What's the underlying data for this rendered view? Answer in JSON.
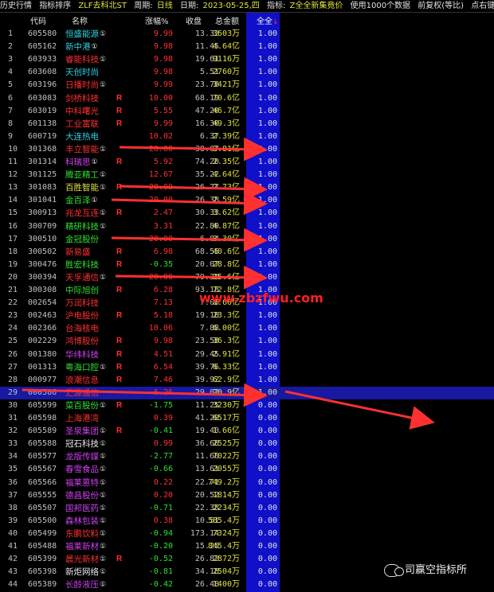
{
  "header": {
    "history": "历史行情",
    "ranking": "指标排序",
    "formula": "ZLF去科北ST",
    "period_label": "周期:",
    "period_value": "日线",
    "date_label": "日期:",
    "date_value": "2023-05-25,四",
    "indicator_label": "指标:",
    "indicator_value": "Z全全新集竟价",
    "data_note": "使用1000个数据",
    "adjust": "前复权(等比)",
    "tail": "点右键"
  },
  "columns": {
    "code": "代码",
    "name": "名称",
    "change": "涨幅%",
    "close": "收盘",
    "amount": "总金额",
    "all": "全全"
  },
  "watermark": "www.zbzfwu.com",
  "brand": "司赢空指标所",
  "colors": {
    "red": "#ff3030",
    "green": "#30e030",
    "yellow": "#e0e040",
    "cyan": "#30d0e0",
    "magenta": "#d040f0",
    "white": "#e8e8e8",
    "blue_column": "#1010c8"
  },
  "rows": [
    {
      "no": "1",
      "code": "605580",
      "name": "恒盛能源",
      "info": "①",
      "r": "",
      "chg": "9.99",
      "close": "13.32",
      "amt": "3603万",
      "all": "1.00",
      "nc": "cyan",
      "cc": "red"
    },
    {
      "no": "2",
      "code": "605162",
      "name": "新中港",
      "info": "①",
      "r": "",
      "chg": "9.98",
      "close": "11.45",
      "amt": "4.64亿",
      "all": "1.00",
      "nc": "cyan",
      "cc": "red"
    },
    {
      "no": "3",
      "code": "603933",
      "name": "睿能科技",
      "info": "①",
      "r": "",
      "chg": "9.98",
      "close": "19.61",
      "amt": "9116万",
      "all": "1.00",
      "nc": "red",
      "cc": "red"
    },
    {
      "no": "4",
      "code": "603608",
      "name": "天创时尚",
      "info": "",
      "r": "",
      "chg": "9.98",
      "close": "5.51",
      "amt": "2760万",
      "all": "1.00",
      "nc": "cyan",
      "cc": "red"
    },
    {
      "no": "5",
      "code": "603196",
      "name": "日播时尚",
      "info": "①",
      "r": "",
      "chg": "9.99",
      "close": "23.78",
      "amt": "3421万",
      "all": "1.00",
      "nc": "red",
      "cc": "red"
    },
    {
      "no": "6",
      "code": "603083",
      "name": "剑桥科技",
      "info": "",
      "r": "R",
      "chg": "10.00",
      "close": "68.19",
      "amt": "70.6亿",
      "all": "1.00",
      "nc": "red",
      "cc": "red"
    },
    {
      "no": "7",
      "code": "603019",
      "name": "中科曙光",
      "info": "",
      "r": "R",
      "chg": "5.55",
      "close": "47.20",
      "amt": "46.7亿",
      "all": "1.00",
      "nc": "red",
      "cc": "red"
    },
    {
      "no": "8",
      "code": "601138",
      "name": "工业富联",
      "info": "",
      "r": "R",
      "chg": "9.99",
      "close": "16.30",
      "amt": "49.3亿",
      "all": "1.00",
      "nc": "red",
      "cc": "red"
    },
    {
      "no": "9",
      "code": "600719",
      "name": "大连热电",
      "info": "",
      "r": "",
      "chg": "10.02",
      "close": "6.37",
      "amt": "2.39亿",
      "all": "1.00",
      "nc": "cyan",
      "cc": "red"
    },
    {
      "no": "10",
      "code": "301368",
      "name": "丰立智能",
      "info": "①",
      "r": "",
      "chg": "20.00",
      "close": "38.07",
      "amt": "3.81亿",
      "all": "1.00",
      "nc": "red",
      "cc": "red"
    },
    {
      "no": "11",
      "code": "301314",
      "name": "科瑞思",
      "info": "①",
      "r": "R",
      "chg": "5.92",
      "close": "74.20",
      "amt": "2.35亿",
      "all": "1.00",
      "nc": "magenta",
      "cc": "red"
    },
    {
      "no": "12",
      "code": "301125",
      "name": "腾亚精工",
      "info": "①",
      "r": "",
      "chg": "12.67",
      "close": "35.22",
      "amt": "4.64亿",
      "all": "1.00",
      "nc": "green",
      "cc": "red"
    },
    {
      "no": "13",
      "code": "301083",
      "name": "百胜智能",
      "info": "①",
      "r": "R",
      "chg": "20.00",
      "close": "26.27",
      "amt": "2.73亿",
      "all": "1.00",
      "nc": "yellow",
      "cc": "red"
    },
    {
      "no": "14",
      "code": "301041",
      "name": "金百泽",
      "info": "①",
      "r": "",
      "chg": "20.00",
      "close": "26.38",
      "amt": "2.59亿",
      "all": "1.00",
      "nc": "green",
      "cc": "red"
    },
    {
      "no": "15",
      "code": "300913",
      "name": "兆龙互连",
      "info": "①",
      "r": "R",
      "chg": "2.47",
      "close": "30.33",
      "amt": "3.62亿",
      "all": "1.00",
      "nc": "red",
      "cc": "red"
    },
    {
      "no": "16",
      "code": "300709",
      "name": "精研科技",
      "info": "①",
      "r": "",
      "chg": "3.31",
      "close": "22.80",
      "amt": "4.87亿",
      "all": "1.00",
      "nc": "green",
      "cc": "red"
    },
    {
      "no": "17",
      "code": "300510",
      "name": "金冠股份",
      "info": "",
      "r": "",
      "chg": "20.00",
      "close": "6.04",
      "amt": "3.30亿",
      "all": "1.00",
      "nc": "green",
      "cc": "red"
    },
    {
      "no": "18",
      "code": "300502",
      "name": "新易盛",
      "info": "",
      "r": "R",
      "chg": "6.98",
      "close": "68.55",
      "amt": "40.6亿",
      "all": "1.00",
      "nc": "red",
      "cc": "red"
    },
    {
      "no": "19",
      "code": "300476",
      "name": "胜宏科技",
      "info": "",
      "r": "R",
      "chg": "-0.35",
      "close": "20.07",
      "amt": "28.8亿",
      "all": "1.00",
      "nc": "green",
      "cc": "green"
    },
    {
      "no": "20",
      "code": "300394",
      "name": "天孚通信",
      "info": "①",
      "r": "",
      "chg": "20.00",
      "close": "79.30",
      "amt": "25.6亿",
      "all": "1.00",
      "nc": "red",
      "cc": "red"
    },
    {
      "no": "21",
      "code": "300308",
      "name": "中际旭创",
      "info": "",
      "r": "R",
      "chg": "6.28",
      "close": "93.18",
      "amt": "72.8亿",
      "all": "1.00",
      "nc": "green",
      "cc": "red"
    },
    {
      "no": "22",
      "code": "002654",
      "name": "万润科技",
      "info": "",
      "r": "",
      "chg": "7.13",
      "close": "7.06",
      "amt": "8.60亿",
      "all": "1.00",
      "nc": "red",
      "cc": "red"
    },
    {
      "no": "23",
      "code": "002463",
      "name": "沪电股份",
      "info": "",
      "r": "R",
      "chg": "5.18",
      "close": "19.10",
      "amt": "23.3亿",
      "all": "1.00",
      "nc": "red",
      "cc": "red"
    },
    {
      "no": "24",
      "code": "002366",
      "name": "台海核电",
      "info": "",
      "r": "",
      "chg": "10.06",
      "close": "7.88",
      "amt": "6.00亿",
      "all": "1.00",
      "nc": "red",
      "cc": "red"
    },
    {
      "no": "25",
      "code": "002229",
      "name": "鸿博股份",
      "info": "",
      "r": "R",
      "chg": "9.98",
      "close": "23.58",
      "amt": "36.3亿",
      "all": "1.00",
      "nc": "red",
      "cc": "red"
    },
    {
      "no": "26",
      "code": "001380",
      "name": "华纬科技",
      "info": "",
      "r": "R",
      "chg": "4.51",
      "close": "29.45",
      "amt": "2.91亿",
      "all": "1.00",
      "nc": "magenta",
      "cc": "red"
    },
    {
      "no": "27",
      "code": "001313",
      "name": "粤海口腔",
      "info": "①",
      "r": "R",
      "chg": "6.54",
      "close": "39.76",
      "amt": "6.33亿",
      "all": "1.00",
      "nc": "green",
      "cc": "red"
    },
    {
      "no": "28",
      "code": "000977",
      "name": "浪潮信息",
      "info": "",
      "r": "R",
      "chg": "7.46",
      "close": "39.92",
      "amt": "62.9亿",
      "all": "1.00",
      "nc": "red",
      "cc": "red"
    },
    {
      "no": "29",
      "code": "000586",
      "name": "汇源通信",
      "info": "",
      "r": "",
      "chg": "6.26",
      "close": "29.02",
      "amt": "20.9亿",
      "all": "1.00",
      "nc": "red",
      "cc": "red",
      "sel": true
    },
    {
      "no": "30",
      "code": "605599",
      "name": "菜百股份",
      "info": "①",
      "r": "R",
      "chg": "-1.75",
      "close": "11.25",
      "amt": "3230万",
      "all": "0.00",
      "nc": "green",
      "cc": "green"
    },
    {
      "no": "31",
      "code": "605598",
      "name": "上海港湾",
      "info": "",
      "r": "",
      "chg": "0.39",
      "close": "41.20",
      "amt": "6517万",
      "all": "0.00",
      "nc": "red",
      "cc": "red"
    },
    {
      "no": "32",
      "code": "605589",
      "name": "圣泉集团",
      "info": "①",
      "r": "R",
      "chg": "-0.41",
      "close": "19.40",
      "amt": "1.66亿",
      "all": "0.00",
      "nc": "magenta",
      "cc": "green"
    },
    {
      "no": "33",
      "code": "605588",
      "name": "冠石科技",
      "info": "①",
      "r": "",
      "chg": "0.99",
      "close": "36.60",
      "amt": "2525万",
      "all": "0.00",
      "nc": "white",
      "cc": "red"
    },
    {
      "no": "34",
      "code": "605577",
      "name": "龙版传媒",
      "info": "①",
      "r": "",
      "chg": "-2.77",
      "close": "11.60",
      "amt": "7022万",
      "all": "0.00",
      "nc": "magenta",
      "cc": "green"
    },
    {
      "no": "35",
      "code": "605567",
      "name": "春雪食品",
      "info": "①",
      "r": "",
      "chg": "-0.66",
      "close": "13.61",
      "amt": "2055万",
      "all": "0.00",
      "nc": "magenta",
      "cc": "green"
    },
    {
      "no": "36",
      "code": "605566",
      "name": "福莱蒽特",
      "info": "①",
      "r": "",
      "chg": "0.22",
      "close": "22.71",
      "amt": "749.2万",
      "all": "0.00",
      "nc": "magenta",
      "cc": "red"
    },
    {
      "no": "37",
      "code": "605555",
      "name": "德昌股份",
      "info": "①",
      "r": "",
      "chg": "0.20",
      "close": "20.52",
      "amt": "1814万",
      "all": "0.00",
      "nc": "magenta",
      "cc": "red"
    },
    {
      "no": "38",
      "code": "605507",
      "name": "国邦医药",
      "info": "①",
      "r": "",
      "chg": "-0.71",
      "close": "22.38",
      "amt": "2234万",
      "all": "0.00",
      "nc": "magenta",
      "cc": "green"
    },
    {
      "no": "39",
      "code": "605500",
      "name": "森林包装",
      "info": "①",
      "r": "",
      "chg": "0.38",
      "close": "10.51",
      "amt": "585.4万",
      "all": "0.00",
      "nc": "magenta",
      "cc": "red"
    },
    {
      "no": "40",
      "code": "605499",
      "name": "东鹏饮料",
      "info": "①",
      "r": "",
      "chg": "-0.94",
      "close": "173.14",
      "amt": "7324万",
      "all": "0.00",
      "nc": "red",
      "cc": "green"
    },
    {
      "no": "41",
      "code": "605488",
      "name": "福莱新材",
      "info": "①",
      "r": "",
      "chg": "-0.20",
      "close": "15.25",
      "amt": "845.4万",
      "all": "0.00",
      "nc": "magenta",
      "cc": "green"
    },
    {
      "no": "42",
      "code": "605399",
      "name": "晨光新材",
      "info": "①",
      "r": "R",
      "chg": "-0.52",
      "close": "26.82",
      "amt": "2872万",
      "all": "0.00",
      "nc": "red",
      "cc": "green"
    },
    {
      "no": "43",
      "code": "605398",
      "name": "新炬网络",
      "info": "①",
      "r": "",
      "chg": "-0.81",
      "close": "34.18",
      "amt": "2504万",
      "all": "0.00",
      "nc": "white",
      "cc": "green"
    },
    {
      "no": "44",
      "code": "605389",
      "name": "长龄液压",
      "info": "①",
      "r": "",
      "chg": "-0.42",
      "close": "26.48",
      "amt": "1400万",
      "all": "0.00",
      "nc": "magenta",
      "cc": "green"
    }
  ]
}
